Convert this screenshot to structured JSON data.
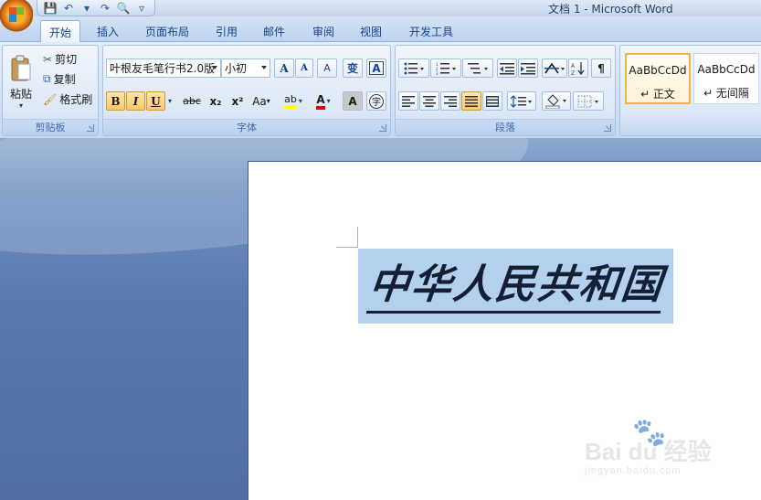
{
  "window": {
    "title": "文档 1 - Microsoft Word"
  },
  "quick_access": [
    {
      "name": "save-icon",
      "glyph": "💾"
    },
    {
      "name": "undo-icon",
      "glyph": "↶"
    },
    {
      "name": "undo-dropdown-icon",
      "glyph": "▾"
    },
    {
      "name": "redo-icon",
      "glyph": "↷"
    },
    {
      "name": "print-preview-icon",
      "glyph": "🔍"
    },
    {
      "name": "customize-qat-icon",
      "glyph": "▿"
    }
  ],
  "tabs": [
    "开始",
    "插入",
    "页面布局",
    "引用",
    "邮件",
    "审阅",
    "视图",
    "开发工具"
  ],
  "clipboard": {
    "paste": "粘贴",
    "cut": "剪切",
    "copy": "复制",
    "format_painter": "格式刷",
    "label": "剪贴板"
  },
  "font": {
    "name": "叶根友毛笔行书2.0版",
    "size": "小初",
    "label": "字体",
    "grow": "A",
    "shrink": "A",
    "clear": "A",
    "phonetic": "变",
    "border": "A",
    "bold": "B",
    "italic": "I",
    "underline": "U",
    "strike": "abc",
    "subscript": "x₂",
    "superscript": "x²",
    "change_case": "Aa",
    "highlight": "ab",
    "color": "A",
    "shading": "A",
    "enclose": "字"
  },
  "paragraph": {
    "label": "段落"
  },
  "styles": [
    {
      "sample": "AaBbCcDd",
      "name": "↵ 正文",
      "selected": true
    },
    {
      "sample": "AaBbCcDd",
      "name": "↵ 无间隔",
      "selected": false
    }
  ],
  "document": {
    "text": "中华人民共和国"
  },
  "watermark": {
    "main": "Bai du 经验",
    "url": "jingyan.baidu.com"
  }
}
